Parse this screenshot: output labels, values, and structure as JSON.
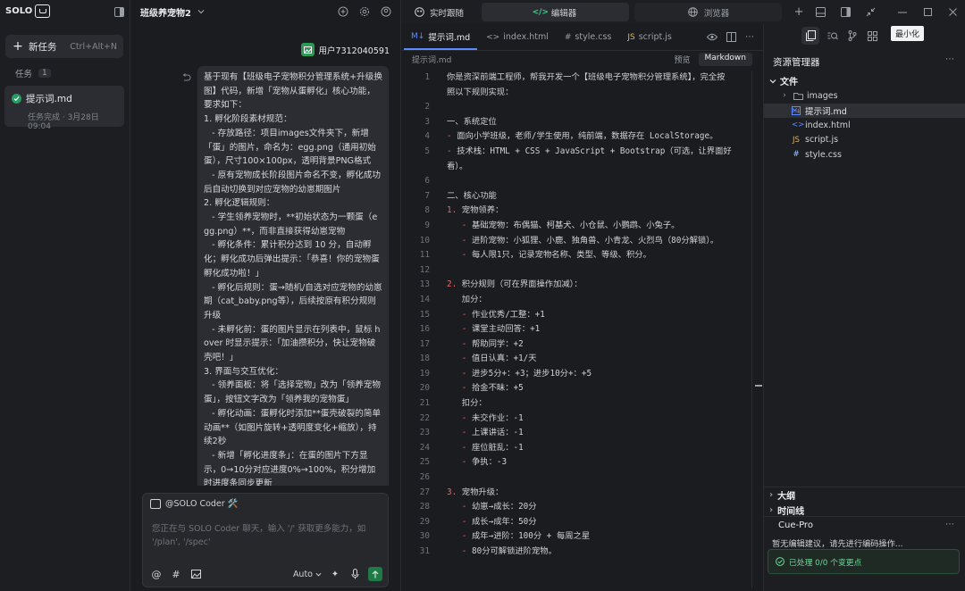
{
  "app": {
    "logo_text": "SOLO"
  },
  "left": {
    "new_task_label": "新任务",
    "new_task_shortcut": "Ctrl+Alt+N",
    "tasks_label": "任务",
    "tasks_count": "1",
    "task": {
      "name": "提示词.md",
      "status": "任务完成 · 3月28日 09:04"
    }
  },
  "chat": {
    "project_title": "班级养宠物2",
    "user_name": "用户7312040591",
    "message": "基于现有【班级电子宠物积分管理系统+升级换图】代码，新增「宠物从蛋孵化」核心功能，要求如下：\n1. 孵化阶段素材规范：\n   - 存放路径：项目images文件夹下，新增「蛋」的图片，命名为：egg.png（通用初始蛋），尺寸100×100px，透明背景PNG格式\n   - 原有宠物成长阶段图片命名不变，孵化成功后自动切换到对应宠物的幼崽期图片\n2. 孵化逻辑规则：\n   - 学生领养宠物时，**初始状态为一颗蛋（egg.png）**，而非直接获得幼崽宠物\n   - 孵化条件：累计积分达到 10 分，自动孵化；孵化成功后弹出提示：「恭喜！你的宠物蛋孵化成功啦！」\n   - 孵化后规则：蛋→随机/自选对应宠物的幼崽期（cat_baby.png等），后续按原有积分规则升级\n   - 未孵化前：蛋的图片显示在列表中，鼠标 hover 时显示提示：「加油攒积分，快让宠物破壳吧！」\n3. 界面与交互优化：\n   - 领养面板：将「选择宠物」改为「领养宠物蛋」，按钮文字改为「领养我的宠物蛋」\n   - 孵化动画：蛋孵化时添加**蛋壳破裂的简单动画**（如图片旋转+透明度变化+缩放），持续2秒\n   - 新增「孵化进度条」：在蛋的图片下方显示，0→10分对应进度0%→100%，积分增加时进度条同步更新\n   - 宠物成长预览模块：新增「蛋」的缩略",
    "input_tag": "@SOLO Coder 🛠️",
    "input_placeholder": "您正在与 SOLO Coder 聊天，输入 '/' 获取更多能力，如 '/plan', '/spec'",
    "mode_label": "Auto"
  },
  "topbar": {
    "realtime_tab": "实时跟随",
    "editor_tab": "编辑器",
    "browser_tab": "浏览器"
  },
  "editor": {
    "tabs": [
      {
        "label": "提示词.md",
        "icon": "M↓"
      },
      {
        "label": "index.html",
        "icon": "<>"
      },
      {
        "label": "style.css",
        "icon": "#"
      },
      {
        "label": "script.js",
        "icon": "JS"
      }
    ],
    "breadcrumb": "提示词.md",
    "mode_preview": "预览",
    "mode_markdown": "Markdown"
  },
  "code_lines": [
    {
      "n": "1",
      "t": "你是资深前端工程师，帮我开发一个【班级电子宠物积分管理系统】，完全按"
    },
    {
      "n": "",
      "t": "照以下规则实现："
    },
    {
      "n": "2",
      "t": ""
    },
    {
      "n": "3",
      "t": "一、系统定位"
    },
    {
      "n": "4",
      "t": "- 面向小学班级，老师/学生使用，纯前端，数据存在 LocalStorage。"
    },
    {
      "n": "5",
      "t": "- 技术栈：HTML + CSS + JavaScript + Bootstrap（可选，让界面好"
    },
    {
      "n": "",
      "t": "看）。"
    },
    {
      "n": "6",
      "t": ""
    },
    {
      "n": "7",
      "t": "二、核心功能"
    },
    {
      "n": "8",
      "t": "1. 宠物领养："
    },
    {
      "n": "9",
      "t": "   - 基础宠物：布偶猫、柯基犬、小仓鼠、小鹦鹉、小兔子。"
    },
    {
      "n": "10",
      "t": "   - 进阶宠物：小狐狸、小鹿、独角兽、小青龙、火烈鸟（80分解锁）。"
    },
    {
      "n": "11",
      "t": "   - 每人限1只，记录宠物名称、类型、等级、积分。"
    },
    {
      "n": "12",
      "t": ""
    },
    {
      "n": "13",
      "t": "2. 积分规则（可在界面操作加减）："
    },
    {
      "n": "14",
      "t": "   加分："
    },
    {
      "n": "15",
      "t": "   - 作业优秀/工整：+1"
    },
    {
      "n": "16",
      "t": "   - 课堂主动回答：+1"
    },
    {
      "n": "17",
      "t": "   - 帮助同学：+2"
    },
    {
      "n": "18",
      "t": "   - 值日认真：+1/天"
    },
    {
      "n": "19",
      "t": "   - 进步5分+：+3；进步10分+：+5"
    },
    {
      "n": "20",
      "t": "   - 拾金不昧：+5"
    },
    {
      "n": "21",
      "t": "   扣分："
    },
    {
      "n": "22",
      "t": "   - 未交作业：-1"
    },
    {
      "n": "23",
      "t": "   - 上课讲话：-1"
    },
    {
      "n": "24",
      "t": "   - 座位脏乱：-1"
    },
    {
      "n": "25",
      "t": "   - 争执：-3"
    },
    {
      "n": "26",
      "t": ""
    },
    {
      "n": "27",
      "t": "3. 宠物升级："
    },
    {
      "n": "28",
      "t": "   - 幼崽→成长：20分"
    },
    {
      "n": "29",
      "t": "   - 成长→成年：50分"
    },
    {
      "n": "30",
      "t": "   - 成年→进阶：100分 + 每周之星"
    },
    {
      "n": "31",
      "t": "   - 80分可解锁进阶宠物。"
    }
  ],
  "right": {
    "tooltip": "最小化",
    "explorer_title": "资源管理器",
    "files_header": "文件",
    "tree": [
      {
        "name": "images",
        "icon": "folder"
      },
      {
        "name": "提示词.md",
        "icon": "md"
      },
      {
        "name": "index.html",
        "icon": "html"
      },
      {
        "name": "script.js",
        "icon": "js"
      },
      {
        "name": "style.css",
        "icon": "css"
      }
    ],
    "outline_label": "大纲",
    "timeline_label": "时间线",
    "cue_title": "Cue-Pro",
    "cue_message": "暂无编辑建议，请先进行编码操作...",
    "cue_status": "已处理 0/0 个变更点"
  }
}
